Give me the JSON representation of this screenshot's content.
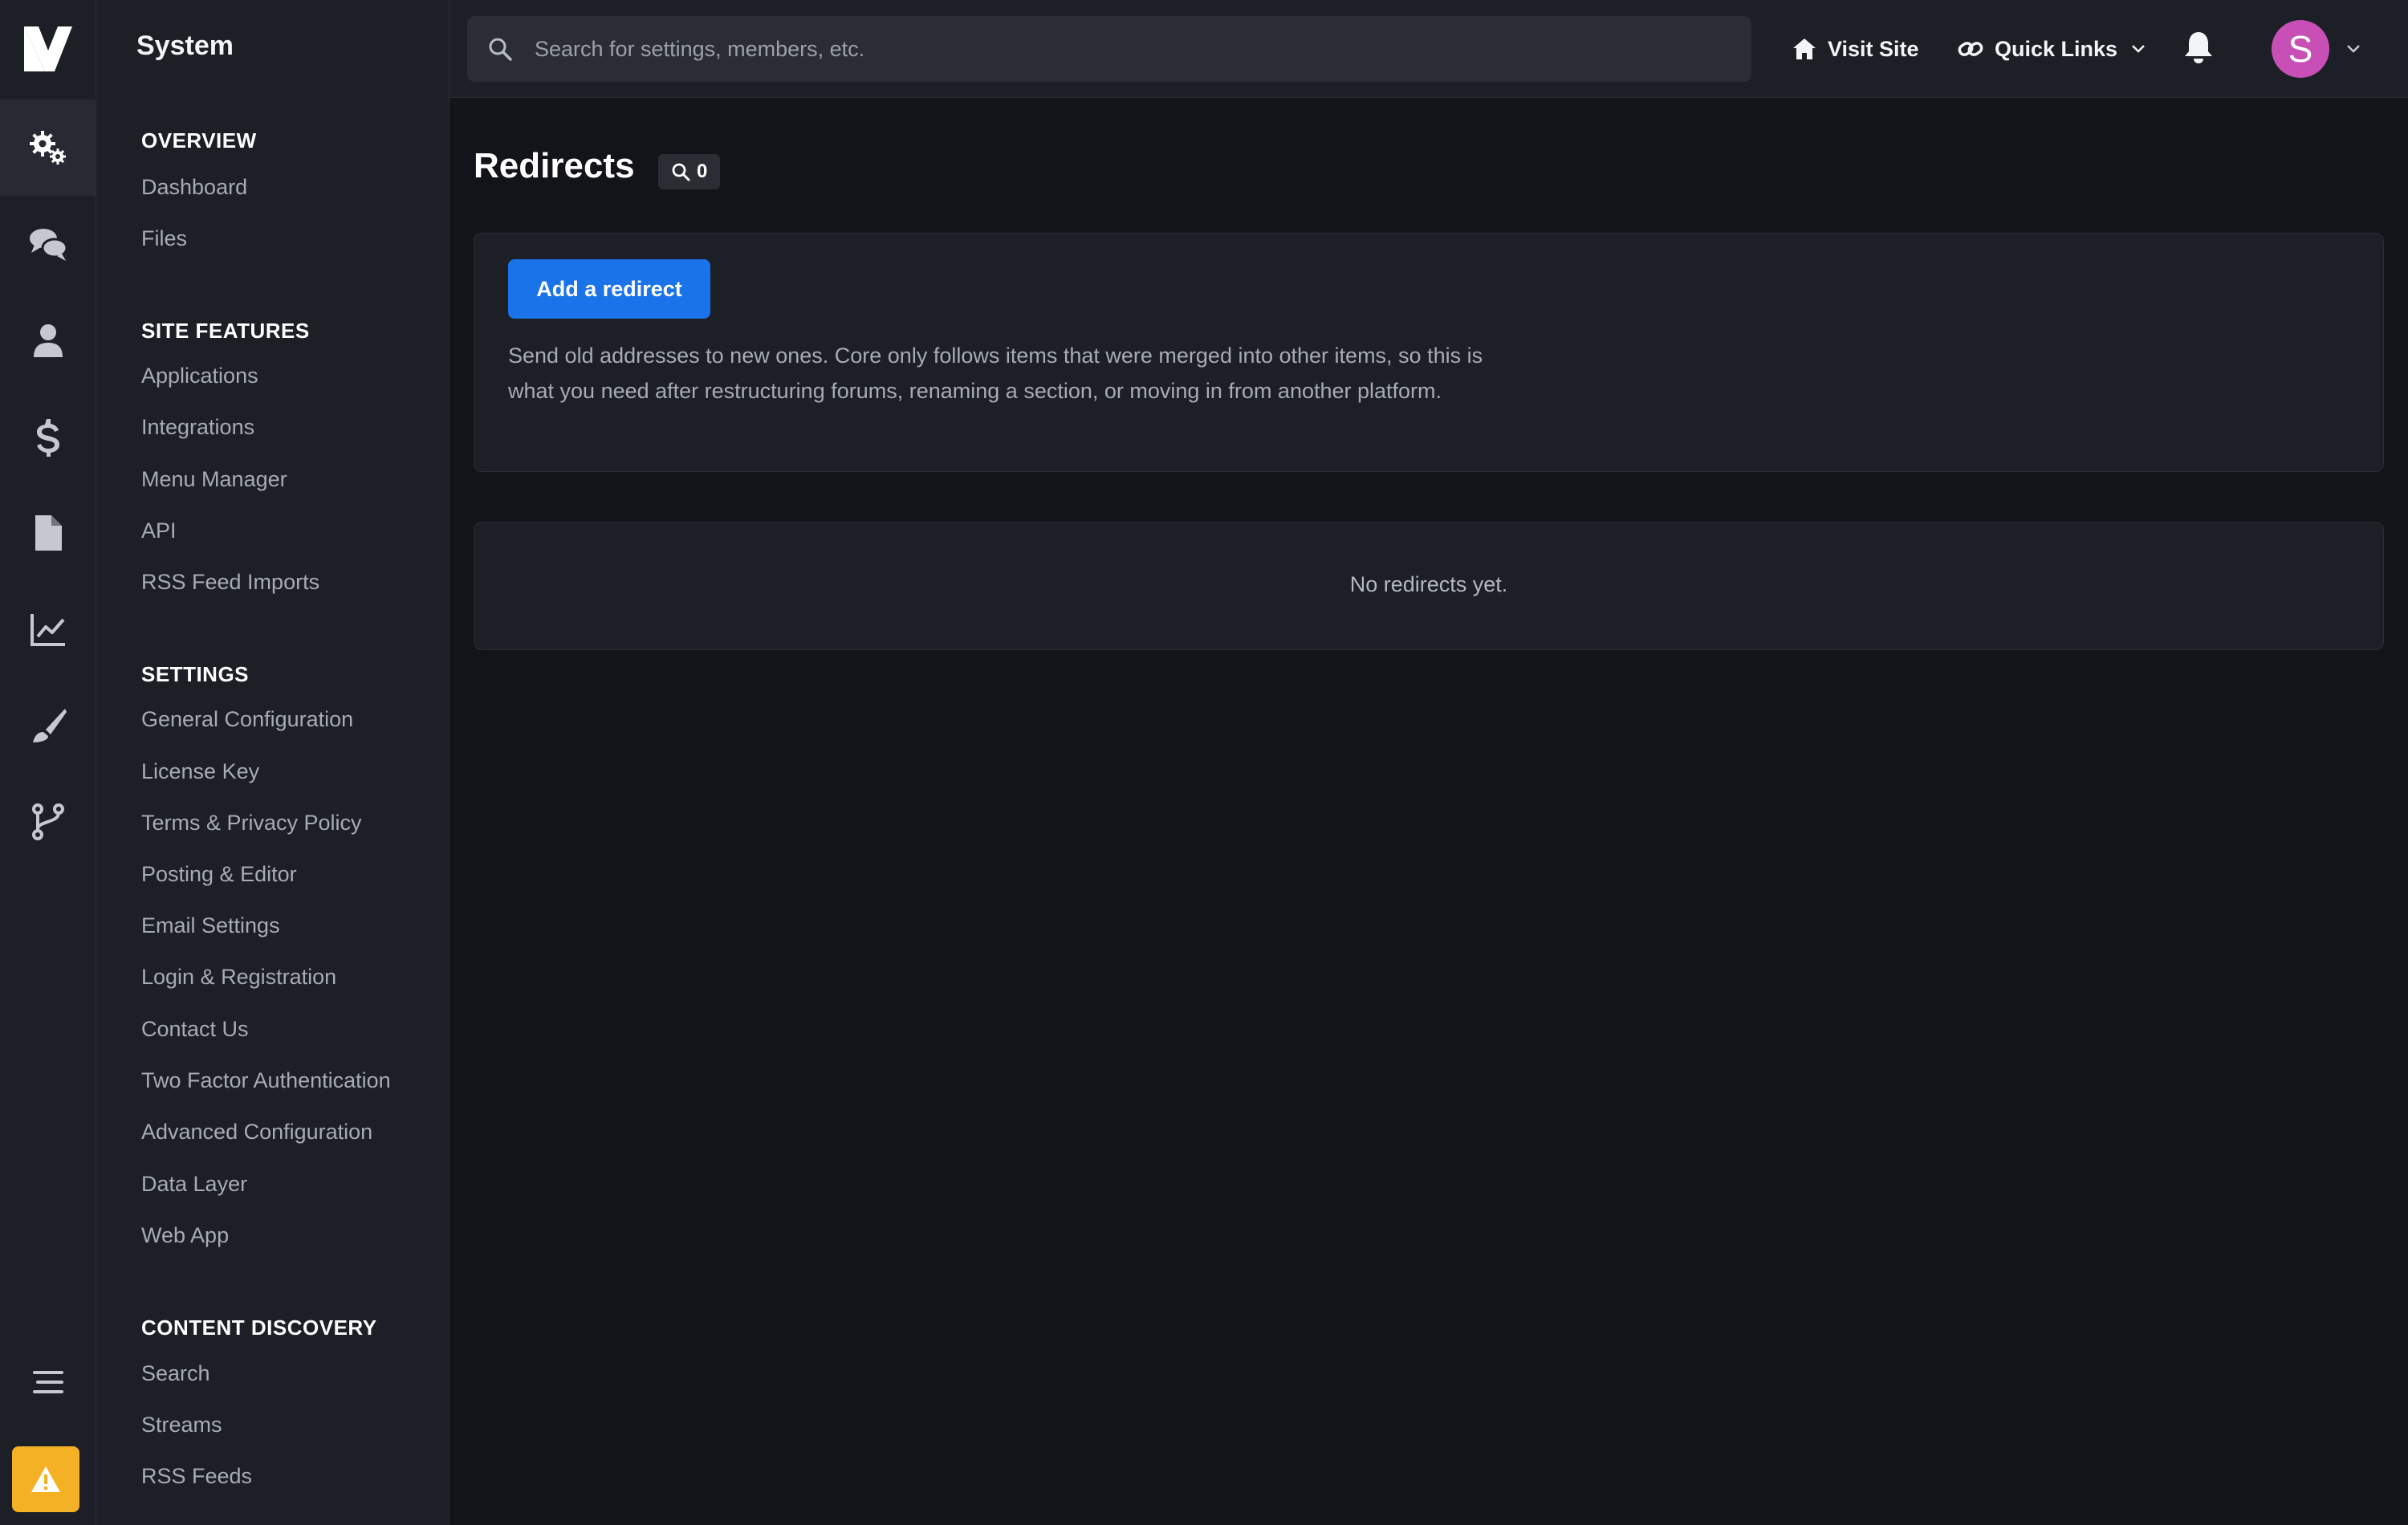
{
  "sidebar": {
    "title": "System",
    "sections": [
      {
        "heading": "OVERVIEW",
        "items": [
          "Dashboard",
          "Files"
        ]
      },
      {
        "heading": "SITE FEATURES",
        "items": [
          "Applications",
          "Integrations",
          "Menu Manager",
          "API",
          "RSS Feed Imports"
        ]
      },
      {
        "heading": "SETTINGS",
        "items": [
          "General Configuration",
          "License Key",
          "Terms & Privacy Policy",
          "Posting & Editor",
          "Email Settings",
          "Login & Registration",
          "Contact Us",
          "Two Factor Authentication",
          "Advanced Configuration",
          "Data Layer",
          "Web App"
        ]
      },
      {
        "heading": "CONTENT DISCOVERY",
        "items": [
          "Search",
          "Streams",
          "RSS Feeds"
        ]
      }
    ]
  },
  "rail": {
    "items": [
      "system-gears-icon",
      "chat-bubbles-icon",
      "user-icon",
      "dollar-icon",
      "file-icon",
      "chart-line-icon",
      "brush-icon",
      "code-branch-icon"
    ],
    "bottom": [
      "menu-bars-icon",
      "warning-icon"
    ]
  },
  "topbar": {
    "search_placeholder": "Search for settings, members, etc.",
    "visit_site": "Visit Site",
    "quick_links": "Quick Links",
    "avatar_initial": "S"
  },
  "main": {
    "title": "Redirects",
    "count": "0",
    "add_button": "Add a redirect",
    "description": "Send old addresses to new ones. Core only follows items that were merged into other items, so this is what you need after restructuring forums, renaming a section, or moving in from another platform.",
    "empty_message": "No redirects yet."
  },
  "colors": {
    "background": "#131419",
    "panel": "#1d1f26",
    "accent": "#1a73e8",
    "warning": "#f5b125",
    "avatar": "#c74fb5"
  }
}
